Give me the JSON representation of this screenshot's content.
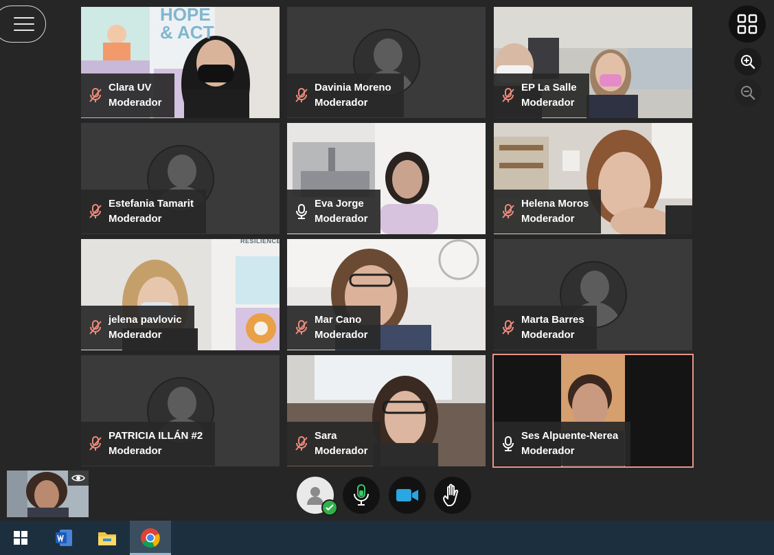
{
  "participants": [
    {
      "name": "Clara UV",
      "role": "Moderador",
      "mic": "muted",
      "video": true
    },
    {
      "name": "Davinia Moreno",
      "role": "Moderador",
      "mic": "muted",
      "video": false
    },
    {
      "name": "EP La Salle",
      "role": "Moderador",
      "mic": "muted",
      "video": true
    },
    {
      "name": "Estefania Tamarit",
      "role": "Moderador",
      "mic": "muted",
      "video": false
    },
    {
      "name": "Eva Jorge",
      "role": "Moderador",
      "mic": "on",
      "video": true
    },
    {
      "name": "Helena Moros",
      "role": "Moderador",
      "mic": "muted",
      "video": true
    },
    {
      "name": "jelena pavlovic",
      "role": "Moderador",
      "mic": "muted",
      "video": true
    },
    {
      "name": "Mar Cano",
      "role": "Moderador",
      "mic": "muted",
      "video": true
    },
    {
      "name": "Marta Barres",
      "role": "Moderador",
      "mic": "muted",
      "video": false
    },
    {
      "name": "PATRICIA ILLÁN #2",
      "role": "Moderador",
      "mic": "muted",
      "video": false
    },
    {
      "name": "Sara",
      "role": "Moderador",
      "mic": "muted",
      "video": true
    },
    {
      "name": "Ses Alpuente-Nerea",
      "role": "Moderador",
      "mic": "on",
      "video": true,
      "active_speaker": true
    }
  ],
  "poster_text": "HOPE & ACT",
  "wall_text": "RESILIENCE",
  "colors": {
    "background": "#262626",
    "label_bg": "#2a2a2a",
    "muted_icon": "#f08a7a",
    "mic_on_green": "#3cc86a",
    "camera_blue": "#2aa6e0",
    "active_border": "#e9968a",
    "taskbar": "#1c2f3f",
    "status_check": "#2eb24a"
  },
  "controls": {
    "top_right": [
      "grid-view-icon",
      "zoom-in-icon",
      "zoom-out-icon"
    ],
    "bottom": [
      "user-status-icon",
      "microphone-icon",
      "camera-icon",
      "raise-hand-icon"
    ]
  },
  "taskbar_apps": [
    "windows-start-icon",
    "word-icon",
    "file-explorer-icon",
    "chrome-icon"
  ]
}
